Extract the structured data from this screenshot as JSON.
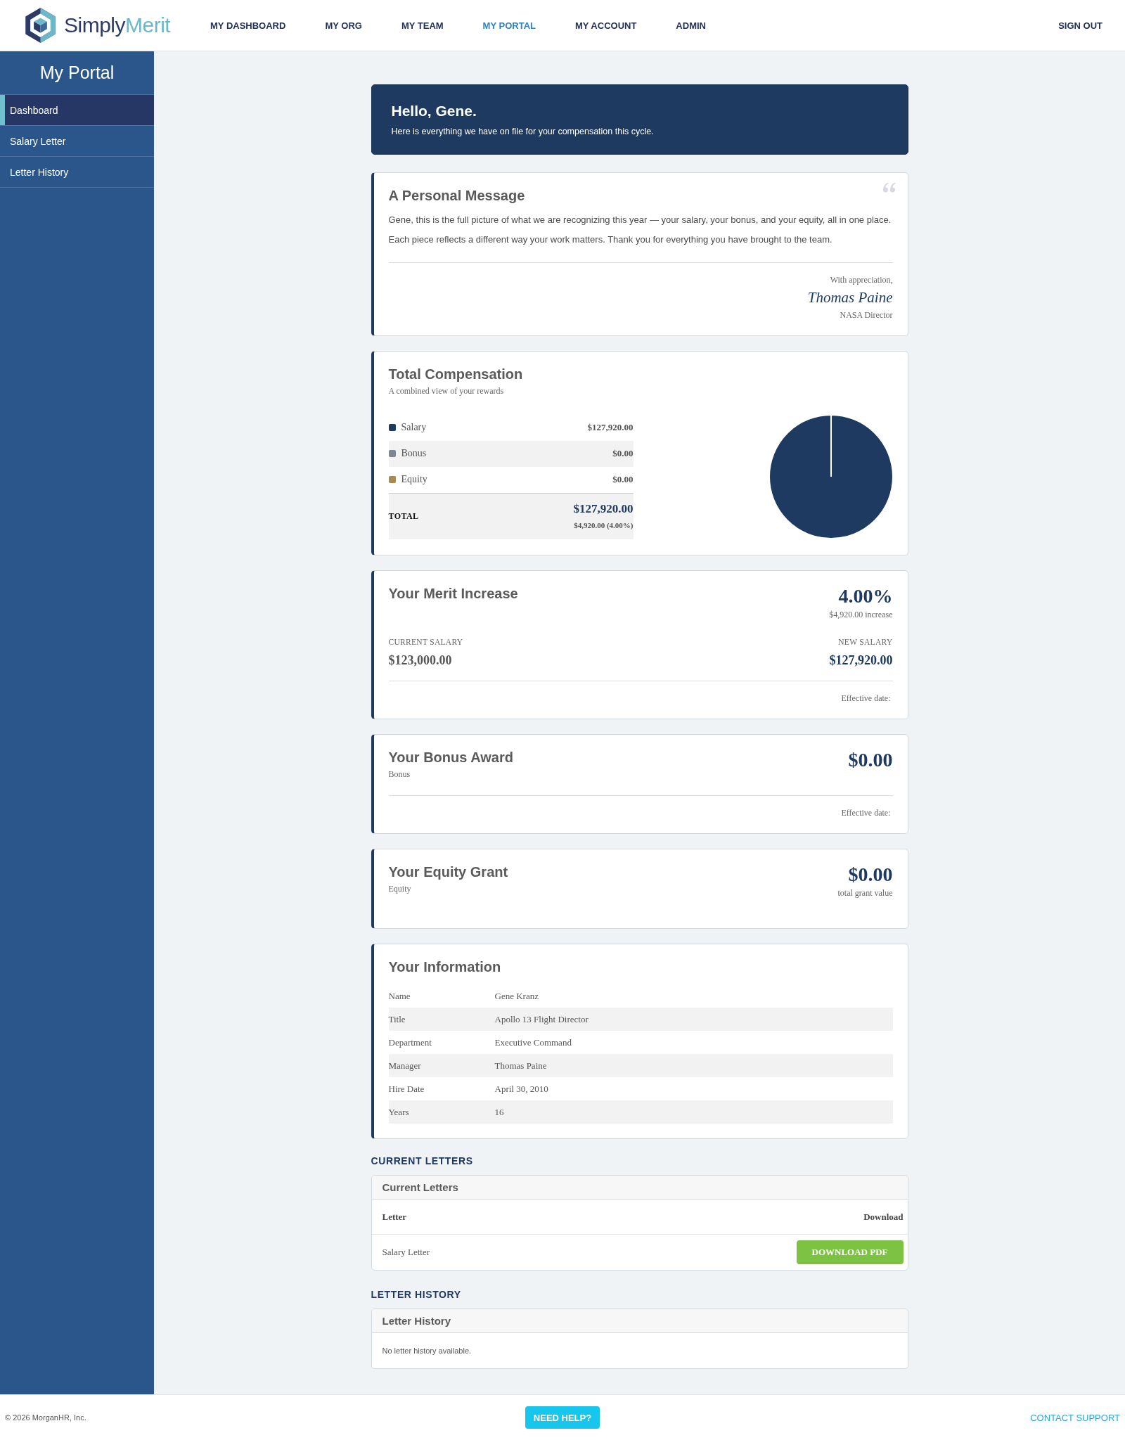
{
  "header": {
    "logo": {
      "primary": "Simply",
      "accent": "Merit"
    },
    "nav": [
      {
        "label": "MY DASHBOARD",
        "selected": false
      },
      {
        "label": "MY ORG",
        "selected": false
      },
      {
        "label": "MY TEAM",
        "selected": false
      },
      {
        "label": "MY PORTAL",
        "selected": true
      },
      {
        "label": "MY ACCOUNT",
        "selected": false
      },
      {
        "label": "ADMIN",
        "selected": false
      }
    ],
    "sign_out": "SIGN OUT"
  },
  "sidebar": {
    "title": "My Portal",
    "items": [
      {
        "label": "Dashboard",
        "selected": true
      },
      {
        "label": "Salary Letter",
        "selected": false
      },
      {
        "label": "Letter History",
        "selected": false
      }
    ]
  },
  "greeting": {
    "title": "Hello, Gene.",
    "subtitle": "Here is everything we have on file for your compensation this cycle."
  },
  "personal_message": {
    "title": "A Personal Message",
    "paragraphs": [
      "Gene, this is the full picture of what we are recognizing this year — your salary, your bonus, and your equity, all in one place.",
      "Each piece reflects a different way your work matters. Thank you for everything you have brought to the team."
    ],
    "closing": "With appreciation,",
    "signature": "Thomas Paine",
    "signer_title": "NASA Director"
  },
  "total_compensation": {
    "title": "Total Compensation",
    "subtitle": "A combined view of your rewards",
    "items": [
      {
        "label": "Salary",
        "amount": "$127,920.00",
        "color": "#1f3a60"
      },
      {
        "label": "Bonus",
        "amount": "$0.00",
        "color": "#7f8794"
      },
      {
        "label": "Equity",
        "amount": "$0.00",
        "color": "#a88a52"
      }
    ],
    "total": {
      "label": "TOTAL",
      "amount": "$127,920.00",
      "change": "$4,920.00 (4.00%)"
    },
    "chart_data": {
      "type": "pie",
      "values": [
        100,
        0,
        0
      ]
    }
  },
  "merit_increase": {
    "title": "Your Merit Increase",
    "percent": "4.00%",
    "increase": "$4,920.00 increase",
    "current_salary": {
      "label": "CURRENT SALARY",
      "value": "$123,000.00"
    },
    "new_salary": {
      "label": "NEW SALARY",
      "value": "$127,920.00"
    },
    "effective_date": "Effective date:"
  },
  "bonus_award": {
    "title": "Your Bonus Award",
    "subtitle": "Bonus",
    "amount": "$0.00",
    "effective_date": "Effective date:"
  },
  "equity_grant": {
    "title": "Your Equity Grant",
    "subtitle": "Equity",
    "amount": "$0.00",
    "amount_note": "total grant value"
  },
  "information": {
    "title": "Your Information",
    "rows": [
      {
        "label": "Name",
        "value": "Gene Kranz"
      },
      {
        "label": "Title",
        "value": "Apollo 13 Flight Director"
      },
      {
        "label": "Department",
        "value": "Executive Command"
      },
      {
        "label": "Manager",
        "value": "Thomas Paine"
      },
      {
        "label": "Hire Date",
        "value": "April 30, 2010"
      },
      {
        "label": "Years",
        "value": "16"
      }
    ]
  },
  "current_letters": {
    "heading": "CURRENT LETTERS",
    "panel_title": "Current Letters",
    "columns": [
      "Letter",
      "Download"
    ],
    "rows": [
      {
        "letter": "Salary Letter",
        "action": "DOWNLOAD PDF"
      }
    ]
  },
  "letter_history": {
    "heading": "LETTER HISTORY",
    "panel_title": "Letter History",
    "empty_message": "No letter history available."
  },
  "footer": {
    "copyright": "© 2026 MorganHR, Inc.",
    "help_button": "NEED HELP?",
    "contact_link": "CONTACT SUPPORT"
  }
}
